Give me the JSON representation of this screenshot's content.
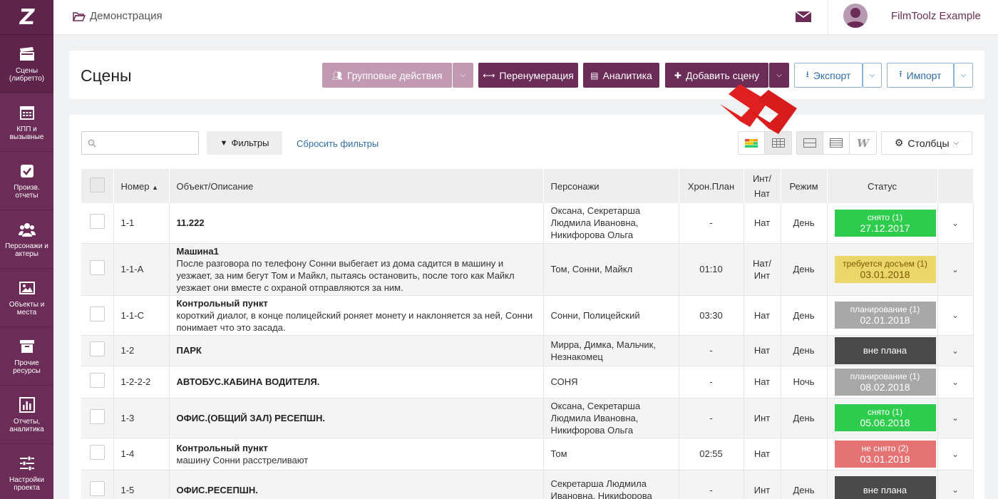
{
  "sidebar": {
    "logo": "Z",
    "items": [
      {
        "label": "Сцены (либретто)",
        "icon": "clapperboard-icon"
      },
      {
        "label": "КПП и вызывные",
        "icon": "calendar-icon"
      },
      {
        "label": "Произв. отчеты",
        "icon": "checkbox-icon"
      },
      {
        "label": "Персонажи и актеры",
        "icon": "users-icon"
      },
      {
        "label": "Объекты и места",
        "icon": "image-icon"
      },
      {
        "label": "Прочие ресурсы",
        "icon": "archive-icon"
      },
      {
        "label": "Отчеты, аналитика",
        "icon": "bar-chart-icon"
      },
      {
        "label": "Настройки проекта",
        "icon": "sliders-icon"
      }
    ]
  },
  "topbar": {
    "breadcrumb": "Демонстрация",
    "user_name": "FilmToolz Example"
  },
  "header": {
    "title": "Сцены",
    "group_actions": "Групповые действия",
    "renumber": "Перенумерация",
    "analytics": "Аналитика",
    "add_scene": "Добавить сцену",
    "export": "Экспорт",
    "import": "Импорт"
  },
  "toolbar": {
    "search_placeholder": "",
    "filters": "Фильтры",
    "reset_filters": "Сбросить фильтры",
    "columns": "Столбцы"
  },
  "table": {
    "columns": [
      "",
      "Номер",
      "Объект/Описание",
      "Персонажи",
      "Хрон.План",
      "Инт/\nНат",
      "Режим",
      "Статус",
      ""
    ],
    "rows": [
      {
        "num": "1-1",
        "title": "11.222",
        "desc": "",
        "chars": "Оксана, Секретарша Людмила Ивановна, Никифорова Ольга",
        "chron": "-",
        "intnat": "Нат",
        "mode": "День",
        "status": "снято (1)",
        "date": "27.12.2017",
        "color": "#2ecc4c"
      },
      {
        "num": "1-1-A",
        "title": "Машина1",
        "desc": "После разговора по телефону Сонни выбегает из дома садится в машину и уезжает, за ним бегут Том и Майкл, пытаясь остановить, после того как Майкл уезжает они вместе с охраной отправляются за ним.",
        "chars": "Том, Сонни, Майкл",
        "chron": "01:10",
        "intnat": "Нат/ Инт",
        "mode": "День",
        "status": "требуется досъем (1)",
        "date": "03.01.2018",
        "color": "#ebd66a"
      },
      {
        "num": "1-1-C",
        "title": "Контрольный пункт",
        "desc": "короткий диалог, в конце полицейский роняет монету и наклоняется за ней, Сонни понимает что это засада.",
        "chars": "Сонни, Полицейский",
        "chron": "03:30",
        "intnat": "Нат",
        "mode": "День",
        "status": "планирование (1)",
        "date": "02.01.2018",
        "color": "#a8a8a8"
      },
      {
        "num": "1-2",
        "title": "ПАРК",
        "desc": "",
        "chars": "Мирра, Димка, Мальчик, Незнакомец",
        "chron": "-",
        "intnat": "Нат",
        "mode": "День",
        "status": "вне плана",
        "date": "",
        "color": "#4a4a4a"
      },
      {
        "num": "1-2-2-2",
        "title": "АВТОБУС.КАБИНА ВОДИТЕЛЯ.",
        "desc": "",
        "chars": "СОНЯ",
        "chron": "-",
        "intnat": "Нат",
        "mode": "Ночь",
        "status": "планирование (1)",
        "date": "08.02.2018",
        "color": "#a8a8a8"
      },
      {
        "num": "1-3",
        "title": "ОФИС.(ОБЩИЙ ЗАЛ) РЕСЕПШН.",
        "desc": "",
        "chars": "Оксана, Секретарша Людмила Ивановна, Никифорова Ольга",
        "chron": "-",
        "intnat": "Инт",
        "mode": "День",
        "status": "снято (1)",
        "date": "05.06.2018",
        "color": "#2ecc4c"
      },
      {
        "num": "1-4",
        "title": "Контрольный пункт",
        "desc": "машину Сонни расстреливают",
        "chars": "Том",
        "chron": "02:55",
        "intnat": "Нат",
        "mode": "",
        "status": "не снято (2)",
        "date": "03.01.2018",
        "color": "#e57373"
      },
      {
        "num": "1-5",
        "title": "ОФИС.РЕСЕПШН.",
        "desc": "",
        "chars": "Секретарша Людмила Ивановна, Никифорова",
        "chron": "-",
        "intnat": "Инт",
        "mode": "День",
        "status": "вне плана",
        "date": "",
        "color": "#4a4a4a"
      }
    ]
  },
  "colors": {
    "brand": "#6b2c57",
    "accent_blue": "#2e6da4"
  }
}
